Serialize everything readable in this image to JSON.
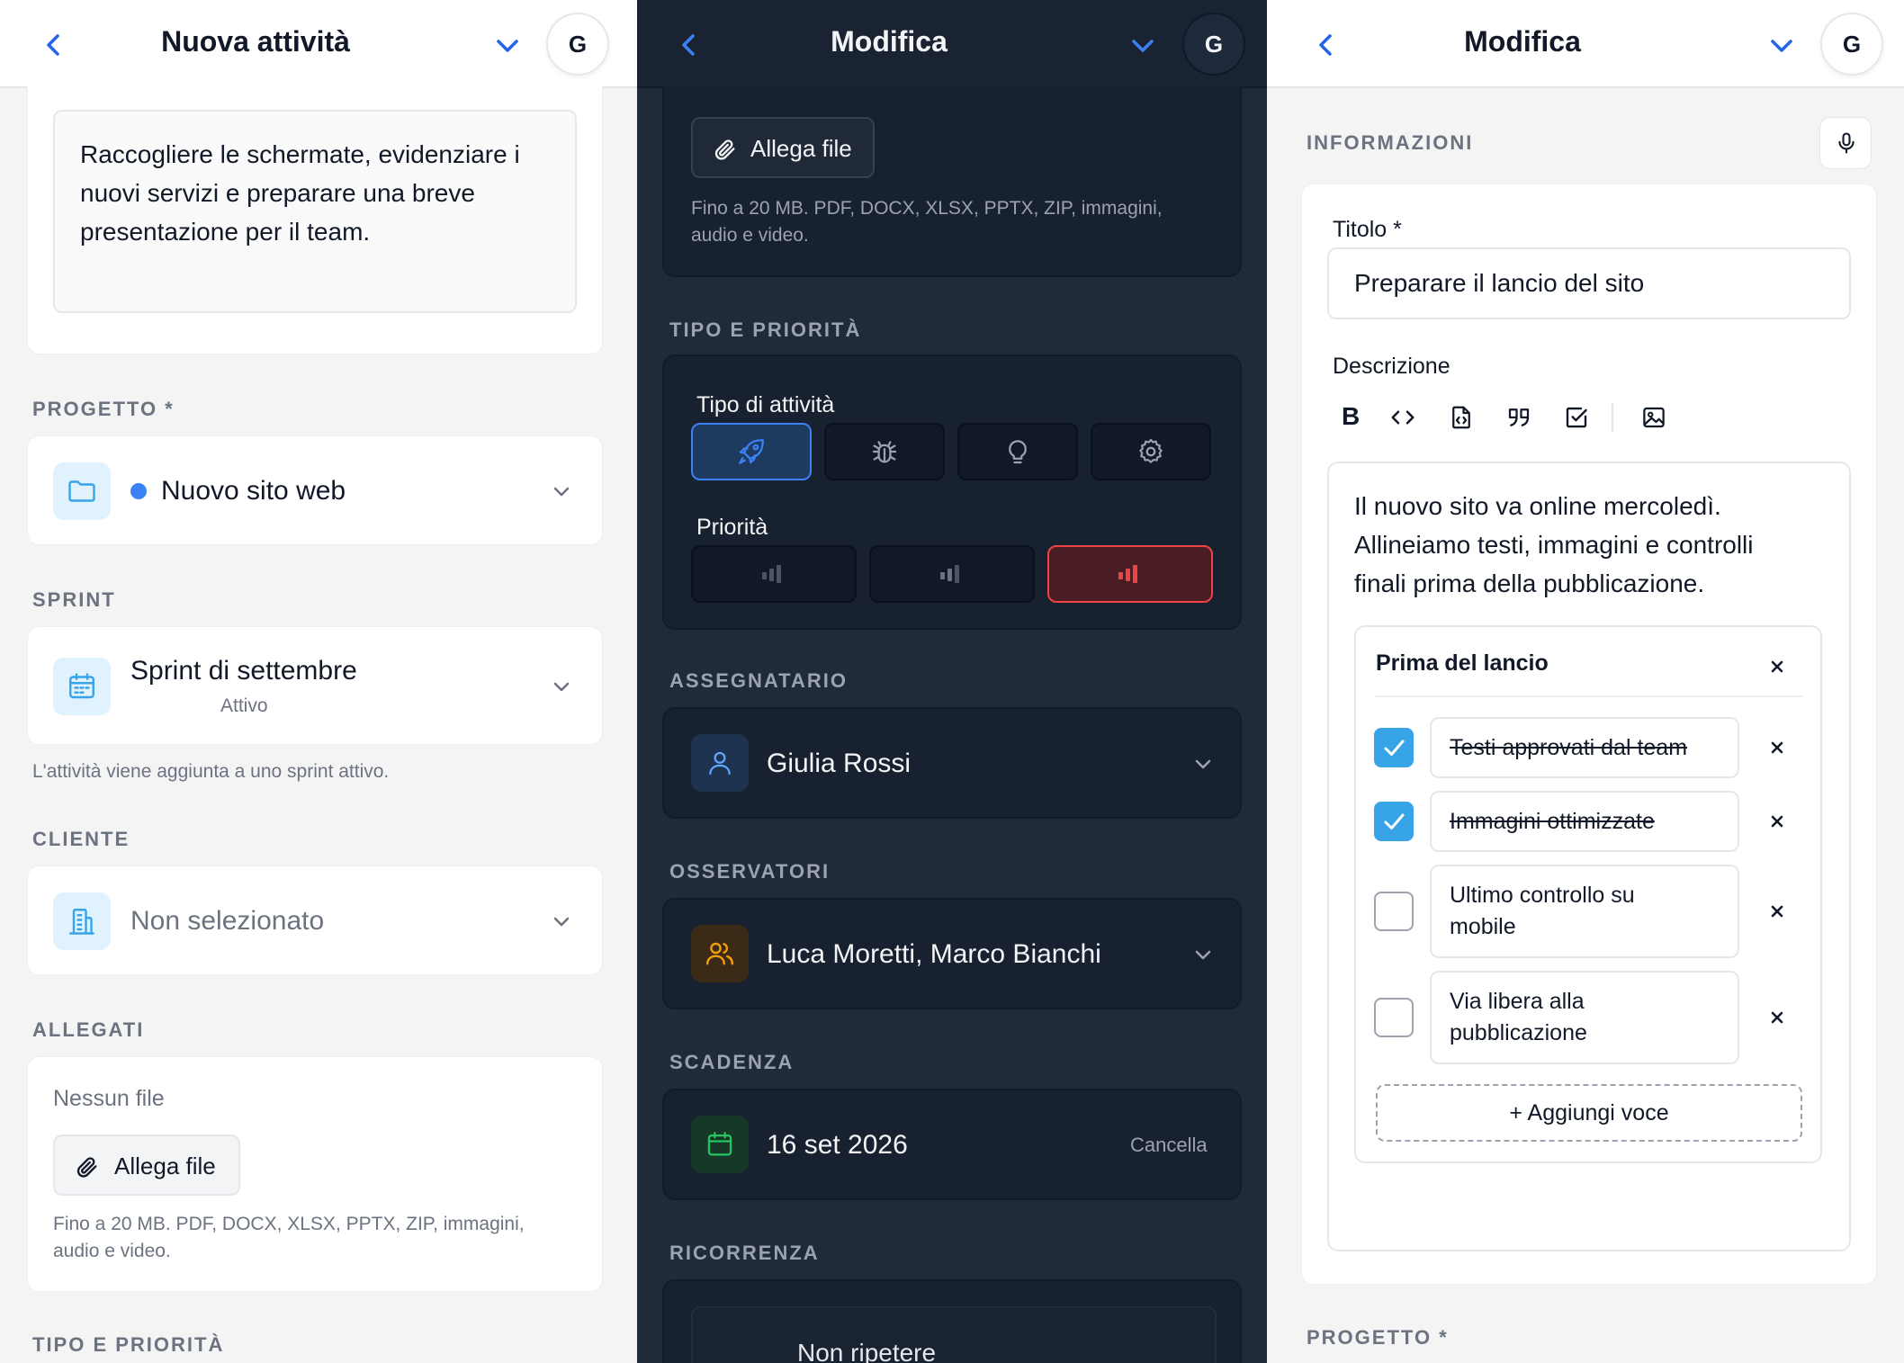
{
  "left": {
    "title": "Nuova attività",
    "avatar": "G",
    "description_text": "Raccogliere le schermate, evidenziare i nuovi servizi e preparare una breve presentazione per il team.",
    "project_label": "PROGETTO *",
    "project_value": "Nuovo sito web",
    "project_dot_color": "#3b82f6",
    "sprint_label": "SPRINT",
    "sprint_value": "Sprint di settembre",
    "sprint_status": "Attivo",
    "sprint_hint": "L'attività viene aggiunta a uno sprint attivo.",
    "client_label": "CLIENTE",
    "client_value": "Non selezionato",
    "attachments_label": "ALLEGATI",
    "no_file": "Nessun file",
    "attach_button": "Allega file",
    "attach_hint_line1": "Fino a 20 MB. PDF, DOCX, XLSX, PPTX, ZIP, immagini,",
    "attach_hint_line2": "audio e video.",
    "type_priority_label": "TIPO E PRIORITÀ"
  },
  "middle": {
    "title": "Modifica",
    "avatar": "G",
    "attach_button": "Allega file",
    "attach_hint_line1": "Fino a 20 MB. PDF, DOCX, XLSX, PPTX, ZIP, immagini,",
    "attach_hint_line2": "audio e video.",
    "type_priority_label": "TIPO E PRIORITÀ",
    "type_label": "Tipo di attività",
    "types": [
      "rocket-icon",
      "bug-icon",
      "lightbulb-icon",
      "gear-icon"
    ],
    "selected_type": "rocket-icon",
    "priority_label": "Priorità",
    "priorities": [
      "low",
      "medium",
      "high"
    ],
    "selected_priority": "high",
    "assignee_label": "ASSEGNATARIO",
    "assignee_value": "Giulia Rossi",
    "watchers_label": "OSSERVATORI",
    "watchers_value": "Luca Moretti, Marco Bianchi",
    "due_label": "SCADENZA",
    "due_value": "16 set 2026",
    "due_clear": "Cancella",
    "recurrence_label": "RICORRENZA",
    "recurrence_value": "Non ripetere",
    "accent_color": "#3b82f6",
    "danger_color": "#ef4444"
  },
  "right": {
    "title": "Modifica",
    "avatar": "G",
    "info_label": "INFORMAZIONI",
    "title_field_label": "Titolo *",
    "title_field_value": "Preparare il lancio del sito",
    "description_label": "Descrizione",
    "toolbar": [
      "bold-icon",
      "code-icon",
      "code-block-icon",
      "quote-icon",
      "checklist-icon",
      "image-icon"
    ],
    "bold_glyph": "B",
    "description_line1": "Il nuovo sito va online mercoledì.",
    "description_line2": "Allineiamo testi, immagini e controlli",
    "description_line3": "finali prima della pubblicazione.",
    "checklist_title": "Prima del lancio",
    "checklist_items": [
      {
        "line1": "Testi approvati dal team",
        "line2": "",
        "done": true
      },
      {
        "line1": "Immagini ottimizzate",
        "line2": "",
        "done": true
      },
      {
        "line1": "Ultimo controllo su",
        "line2": "mobile",
        "done": false
      },
      {
        "line1": "Via libera alla",
        "line2": "pubblicazione",
        "done": false
      }
    ],
    "add_item": "+ Aggiungi voce",
    "project_label": "PROGETTO *",
    "check_color": "#38a4e8"
  }
}
